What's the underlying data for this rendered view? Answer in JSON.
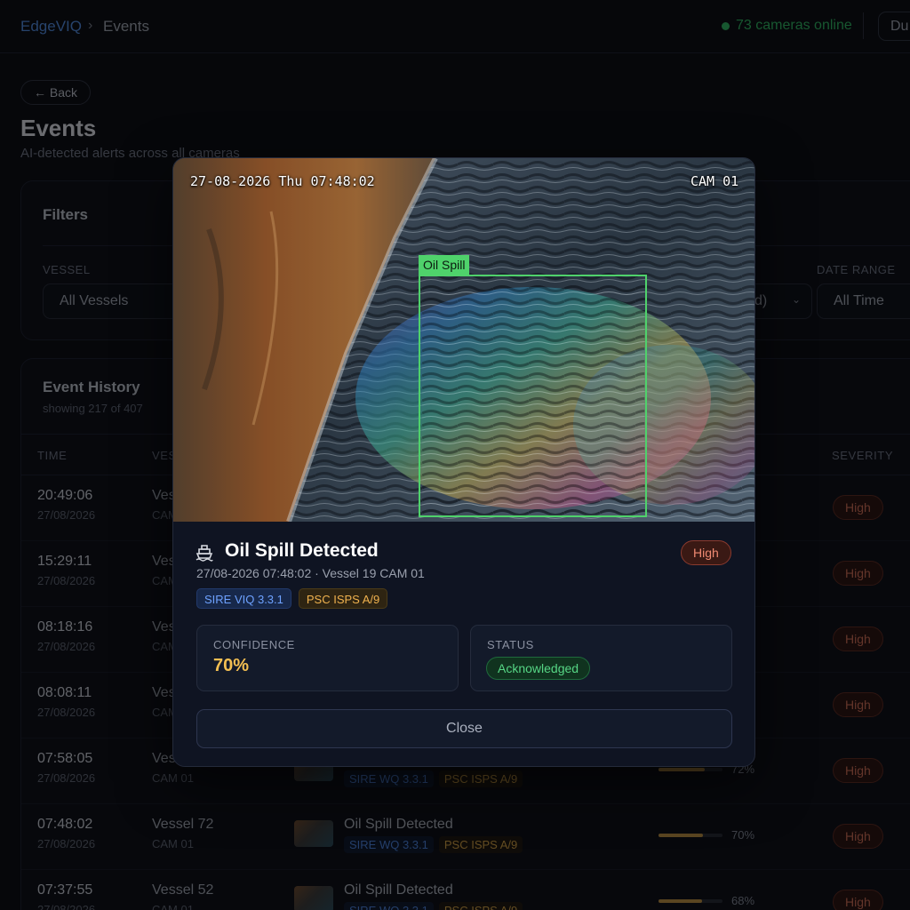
{
  "header": {
    "brand": "EdgeVIQ",
    "separator": "›",
    "current": "Events",
    "cameras_online": "73 cameras online",
    "user_button": "Du"
  },
  "page": {
    "back_label": "← Back",
    "title": "Events",
    "subtitle": "AI-detected alerts across all cameras"
  },
  "filters": {
    "title": "Filters",
    "vessel_label": "VESSEL",
    "vessel_value": "All Vessels",
    "partial_value": "d)",
    "date_label": "DATE RANGE",
    "date_value": "All Time"
  },
  "history": {
    "title": "Event History",
    "showing": "showing 217 of 407",
    "columns": {
      "time": "TIME",
      "vessel": "VES",
      "severity": "SEVERITY"
    },
    "rows": [
      {
        "time": "20:49:06",
        "date": "27/08/2026",
        "vessel": "Vess",
        "cam": "CAM",
        "type": "",
        "sire": "",
        "psc": "",
        "confidence": 0,
        "confidence_text": "",
        "severity": "High"
      },
      {
        "time": "15:29:11",
        "date": "27/08/2026",
        "vessel": "Ves",
        "cam": "CAM",
        "type": "",
        "sire": "",
        "psc": "",
        "confidence": 0,
        "confidence_text": "",
        "severity": "High"
      },
      {
        "time": "08:18:16",
        "date": "27/08/2026",
        "vessel": "Ves",
        "cam": "CAM",
        "type": "",
        "sire": "",
        "psc": "",
        "confidence": 0,
        "confidence_text": "",
        "severity": "High"
      },
      {
        "time": "08:08:11",
        "date": "27/08/2026",
        "vessel": "Ves",
        "cam": "CAM",
        "type": "",
        "sire": "",
        "psc": "",
        "confidence": 0,
        "confidence_text": "",
        "severity": "High"
      },
      {
        "time": "07:58:05",
        "date": "27/08/2026",
        "vessel": "Ves",
        "cam": "CAM 01",
        "type": "",
        "sire": "SIRE WQ 3.3.1",
        "psc": "PSC ISPS A/9",
        "confidence": 0.72,
        "confidence_text": "72%",
        "severity": "High"
      },
      {
        "time": "07:48:02",
        "date": "27/08/2026",
        "vessel": "Vessel 72",
        "cam": "CAM 01",
        "type": "Oil Spill Detected",
        "sire": "SIRE WQ 3.3.1",
        "psc": "PSC ISPS A/9",
        "confidence": 0.7,
        "confidence_text": "70%",
        "severity": "High"
      },
      {
        "time": "07:37:55",
        "date": "27/08/2026",
        "vessel": "Vessel 52",
        "cam": "CAM 01",
        "type": "Oil Spill Detected",
        "sire": "SIRE WQ 3.3.1",
        "psc": "PSC ISPS A/9",
        "confidence": 0.68,
        "confidence_text": "68%",
        "severity": "High"
      }
    ]
  },
  "modal": {
    "osd_timestamp": "27-08-2026 Thu 07:48:02",
    "osd_camera": "CAM 01",
    "detection_label": "Oil Spill",
    "icon": "ship-icon",
    "title": "Oil Spill Detected",
    "severity": "High",
    "meta": "27/08-2026 07:48:02 · Vessel 19 CAM 01",
    "tags": {
      "sire": "SIRE VIQ 3.3.1",
      "psc": "PSC ISPS A/9"
    },
    "confidence_label": "CONFIDENCE",
    "confidence_value": "70%",
    "status_label": "STATUS",
    "status_value": "Acknowledged",
    "close_label": "Close"
  },
  "colors": {
    "accent_blue": "#4f87d8",
    "online_green": "#2fae60",
    "bbox_green": "#4fd26b",
    "severity_red": "#f08a72",
    "confidence_amber": "#f3bf52"
  }
}
